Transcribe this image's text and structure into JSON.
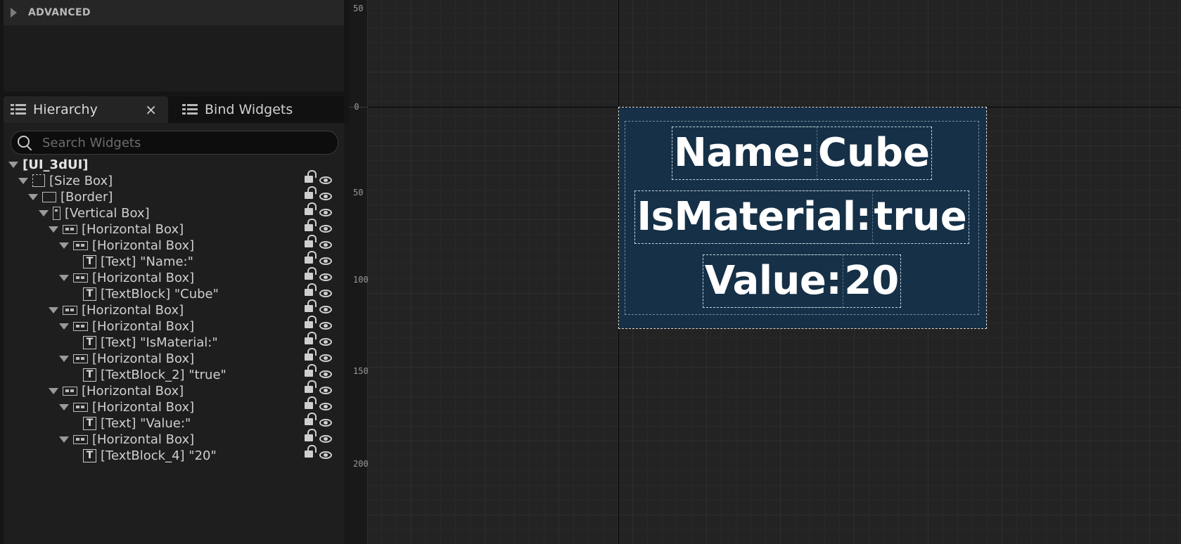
{
  "advanced": {
    "label": "ADVANCED"
  },
  "tabs": {
    "hierarchy": {
      "label": "Hierarchy",
      "close": "×"
    },
    "bind_widgets": {
      "label": "Bind Widgets"
    }
  },
  "search": {
    "placeholder": "Search Widgets",
    "value": ""
  },
  "tree": [
    {
      "label": "[UI_3dUI]"
    },
    {
      "label": "[Size Box]"
    },
    {
      "label": "[Border]"
    },
    {
      "label": "[Vertical Box]"
    },
    {
      "label": "[Horizontal Box]"
    },
    {
      "label": "[Horizontal Box]"
    },
    {
      "label": "[Text] \"Name:\""
    },
    {
      "label": "[Horizontal Box]"
    },
    {
      "label": "[TextBlock] \"Cube\""
    },
    {
      "label": "[Horizontal Box]"
    },
    {
      "label": "[Horizontal Box]"
    },
    {
      "label": "[Text] \"IsMaterial:\""
    },
    {
      "label": "[Horizontal Box]"
    },
    {
      "label": "[TextBlock_2] \"true\""
    },
    {
      "label": "[Horizontal Box]"
    },
    {
      "label": "[Horizontal Box]"
    },
    {
      "label": "[Text] \"Value:\""
    },
    {
      "label": "[Horizontal Box]"
    },
    {
      "label": "[TextBlock_4] \"20\""
    }
  ],
  "ruler": [
    "50",
    "0",
    "50",
    "100",
    "150",
    "200"
  ],
  "preview": {
    "rows": [
      {
        "key": "Name:",
        "value": "Cube"
      },
      {
        "key": "IsMaterial:",
        "value": "true"
      },
      {
        "key": "Value:",
        "value": "20"
      }
    ]
  },
  "colors": {
    "panel_bg": "#1e1e1e",
    "canvas_bg": "#232323",
    "widget_bg": "#153047",
    "text": "#ffffff"
  }
}
